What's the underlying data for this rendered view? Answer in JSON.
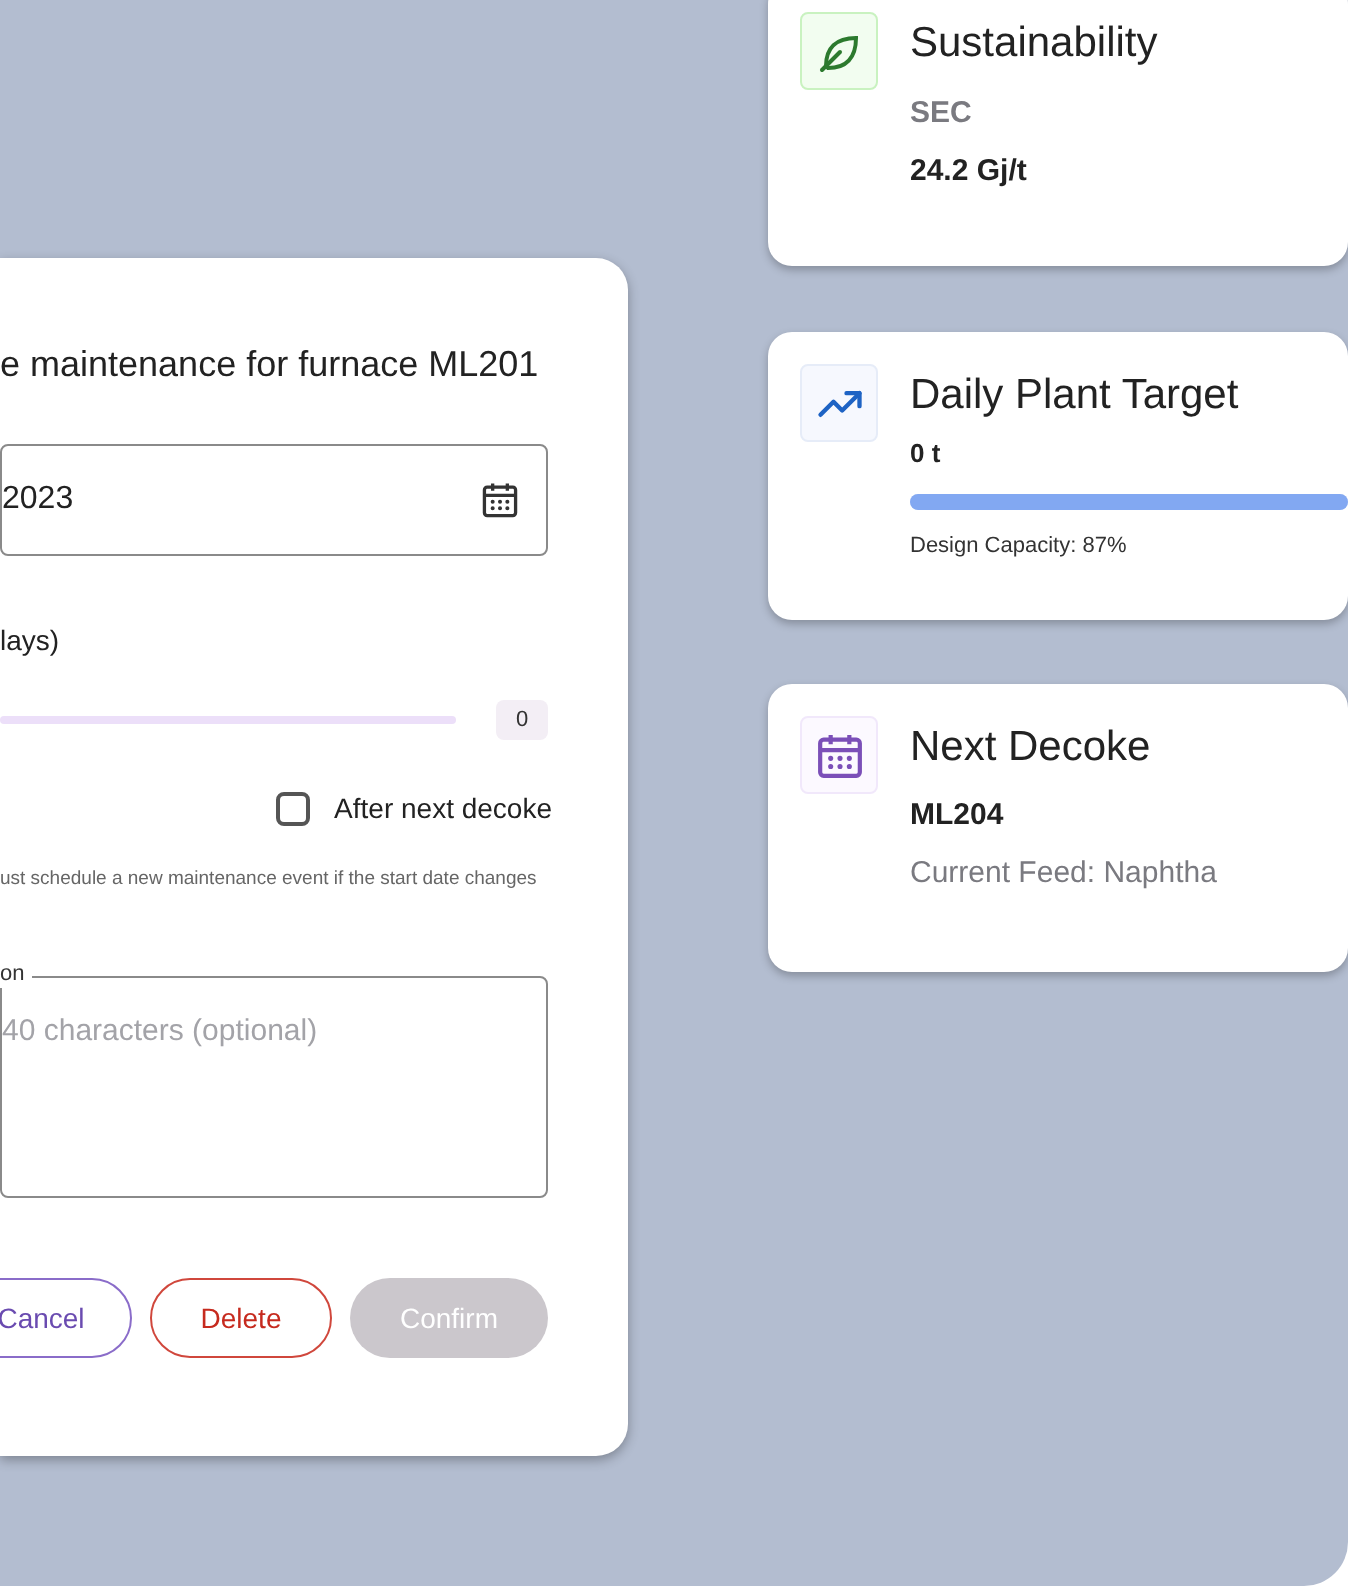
{
  "dialog": {
    "title": "e maintenance for furnace ML201",
    "date_field": {
      "value": "2023"
    },
    "duration": {
      "label": "lays)",
      "level": 0,
      "reading": "0"
    },
    "after_next_decoke": {
      "label": "After next decoke",
      "checked": false
    },
    "helper": "ust schedule a new maintenance event if the start date changes",
    "description": {
      "label": "on",
      "placeholder": "40 characters (optional)"
    },
    "buttons": [
      {
        "kind": "outline-purple",
        "label": "Cancel",
        "disabled": false
      },
      {
        "kind": "outline-red",
        "label": "Delete",
        "disabled": false
      },
      {
        "kind": "filled",
        "label": "Confirm",
        "disabled": true
      }
    ]
  },
  "cards": [
    {
      "kind": "sustainability",
      "title": "Sustainability",
      "lines": [
        "SEC",
        "24.2 Gj/t"
      ]
    },
    {
      "kind": "target",
      "title": "Daily Plant Target",
      "lines": [
        "0 t",
        "Design Capacity: 87%"
      ],
      "level": 1
    },
    {
      "kind": "decoke",
      "title": "Next Decoke",
      "lines": [
        "ML204",
        "Current Feed: Naphtha"
      ]
    }
  ]
}
